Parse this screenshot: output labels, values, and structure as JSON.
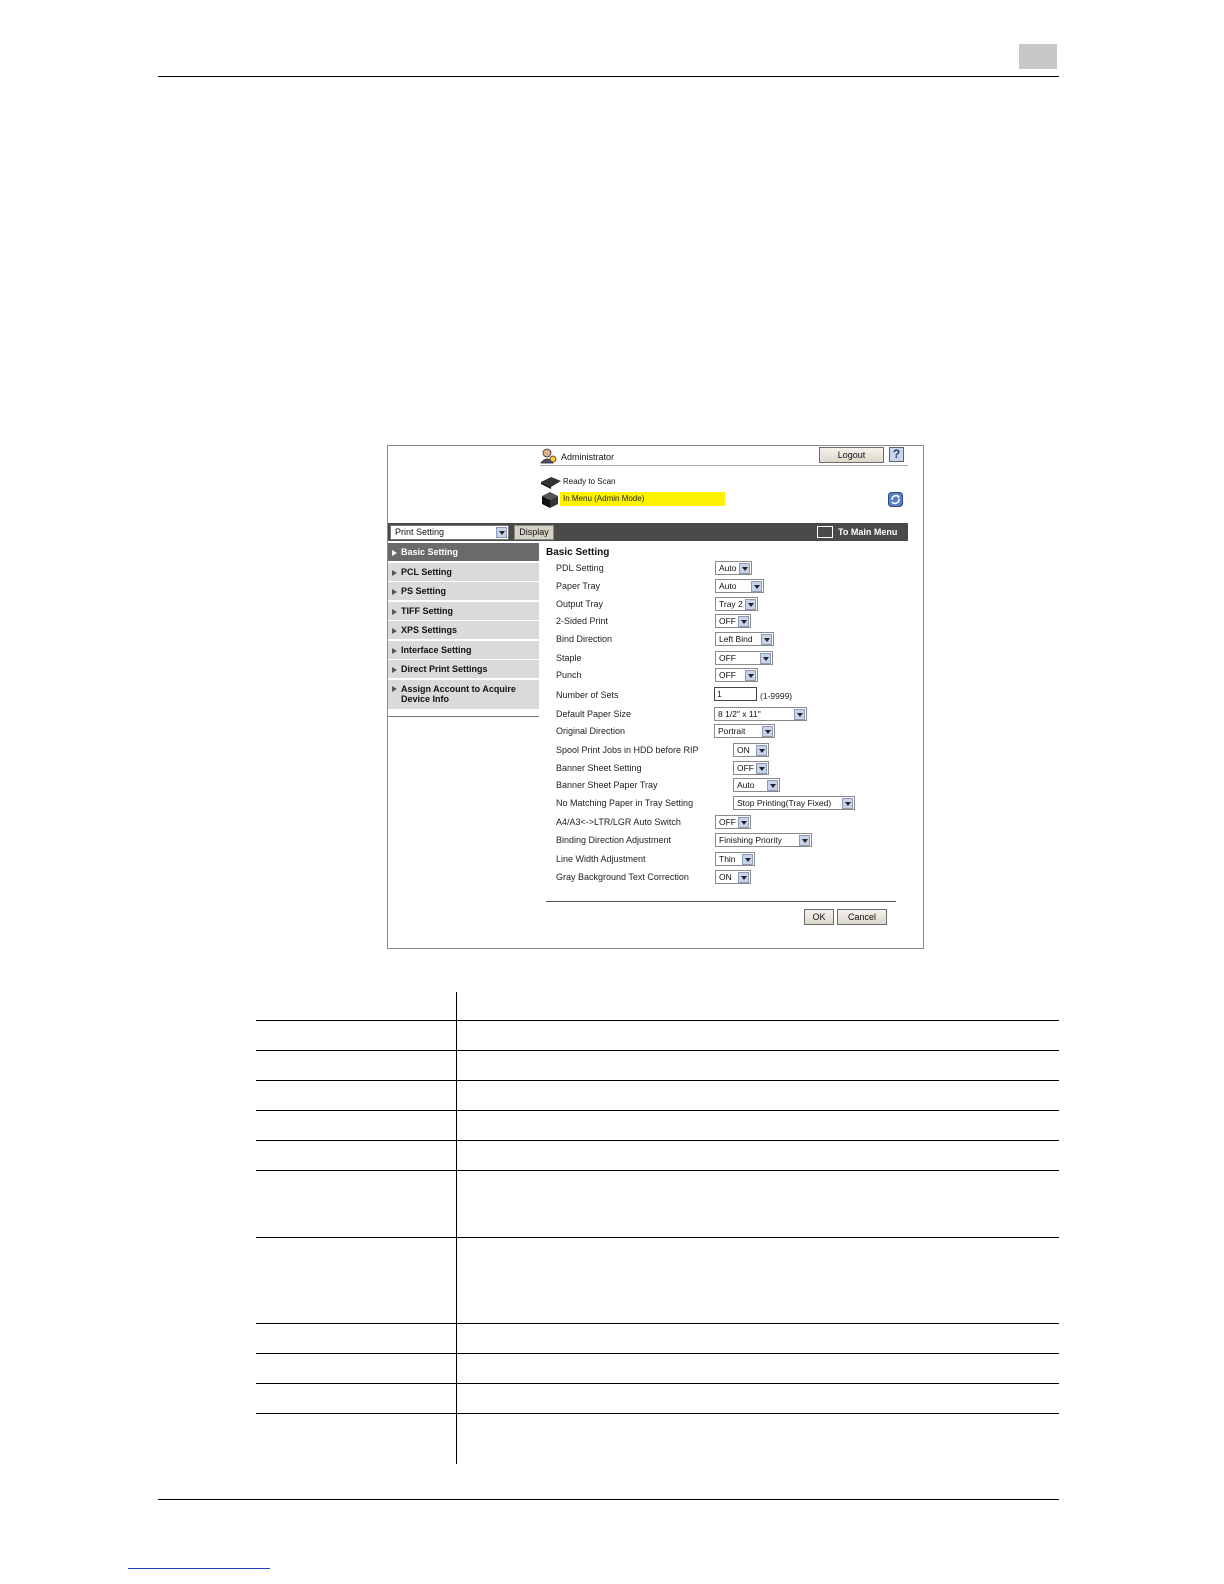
{
  "screenshot": {
    "user_label": "Administrator",
    "logout_label": "Logout",
    "help_label": "?",
    "status_ready": "Ready to Scan",
    "status_mode": "In Menu (Admin Mode)",
    "category_select": "Print Setting",
    "display_label": "Display",
    "to_main_menu": "To Main Menu",
    "nav": [
      {
        "label": "Basic Setting"
      },
      {
        "label": "PCL Setting"
      },
      {
        "label": "PS Setting"
      },
      {
        "label": "TIFF Setting"
      },
      {
        "label": "XPS Settings"
      },
      {
        "label": "Interface Setting"
      },
      {
        "label": "Direct Print Settings"
      },
      {
        "label_line1": "Assign Account to Acquire",
        "label_line2": "Device Info"
      }
    ],
    "form_title": "Basic Setting",
    "fields": [
      {
        "label": "PDL Setting",
        "value": "Auto"
      },
      {
        "label": "Paper Tray",
        "value": "Auto"
      },
      {
        "label": "Output Tray",
        "value": "Tray 2"
      },
      {
        "label": "2-Sided Print",
        "value": "OFF"
      },
      {
        "label": "Bind Direction",
        "value": "Left Bind"
      },
      {
        "label": "Staple",
        "value": "OFF"
      },
      {
        "label": "Punch",
        "value": "OFF"
      },
      {
        "label": "Number of Sets",
        "value": "1",
        "hint": "(1-9999)"
      },
      {
        "label": "Default Paper Size",
        "value": "8 1/2\" x 11\""
      },
      {
        "label": "Original Direction",
        "value": "Portrait"
      },
      {
        "label": "Spool Print Jobs in HDD before RIP",
        "value": "ON"
      },
      {
        "label": "Banner Sheet Setting",
        "value": "OFF"
      },
      {
        "label": "Banner Sheet Paper Tray",
        "value": "Auto"
      },
      {
        "label": "No Matching Paper in Tray Setting",
        "value": "Stop Printing(Tray Fixed)"
      },
      {
        "label": "A4/A3<->LTR/LGR Auto Switch",
        "value": "OFF"
      },
      {
        "label": "Binding Direction Adjustment",
        "value": "Finishing Priority"
      },
      {
        "label": "Line Width Adjustment",
        "value": "Thin"
      },
      {
        "label": "Gray Background Text Correction",
        "value": "ON"
      }
    ],
    "ok_label": "OK",
    "cancel_label": "Cancel"
  }
}
